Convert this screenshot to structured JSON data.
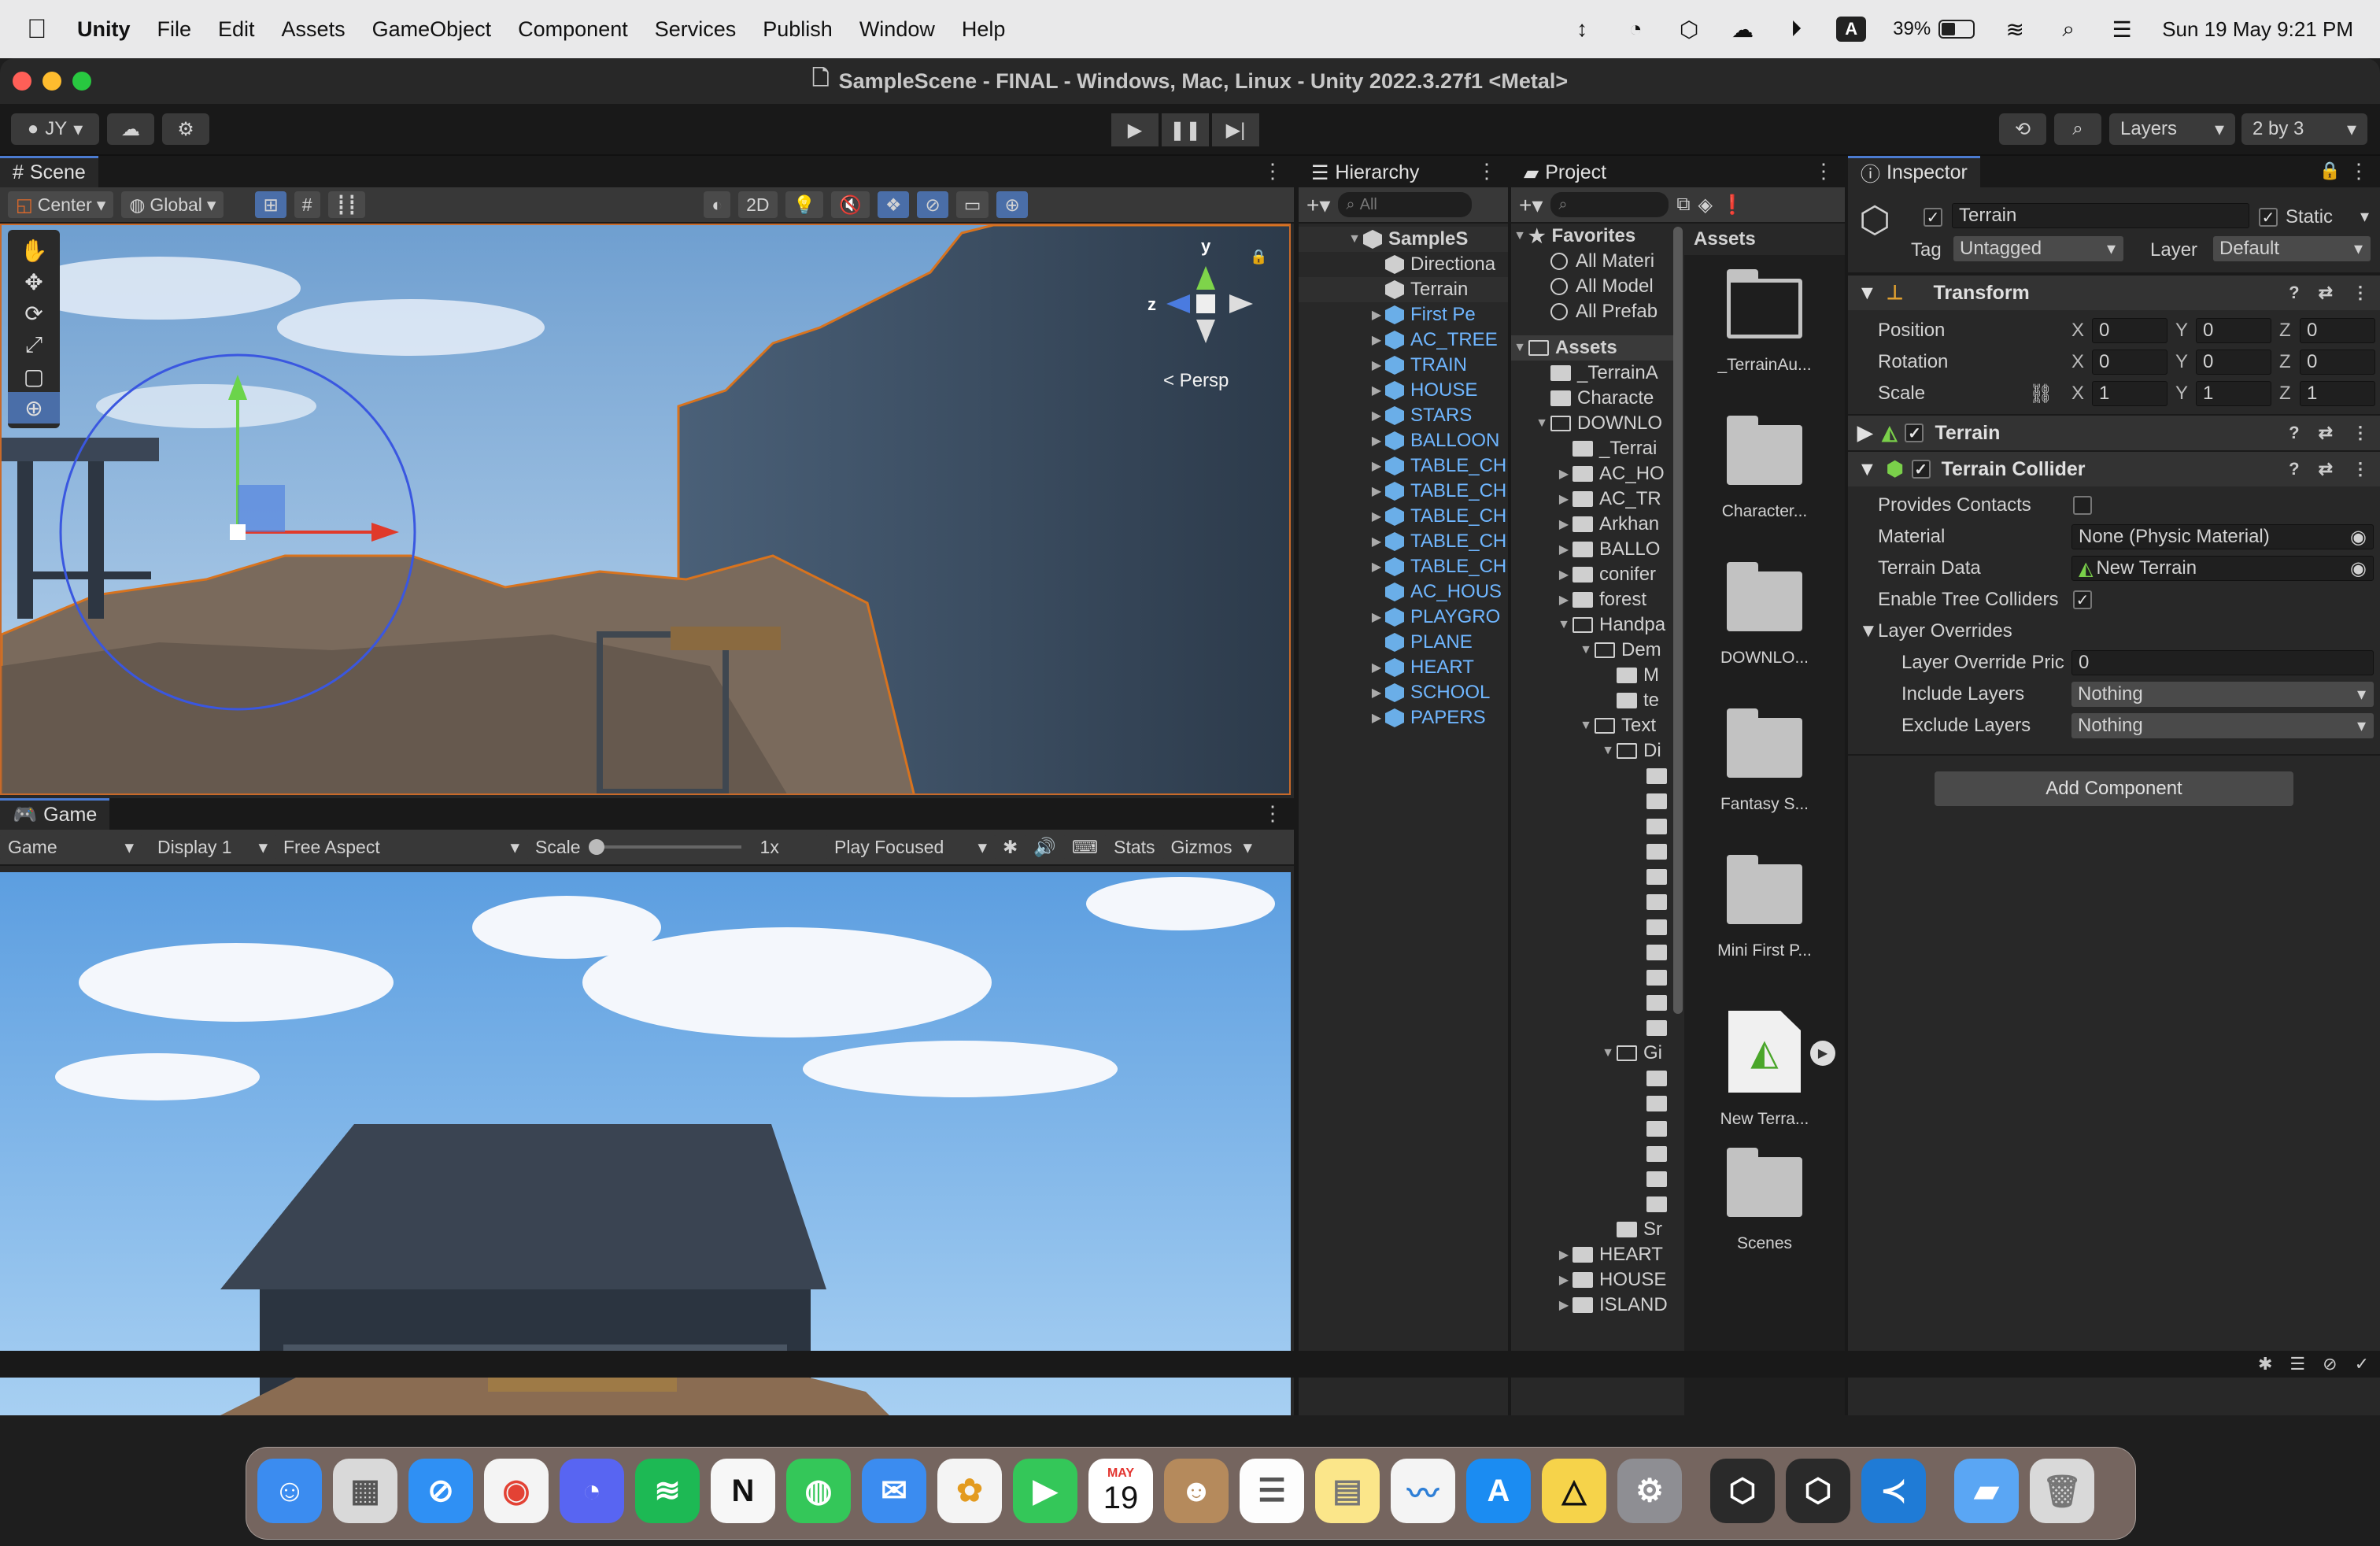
{
  "menubar": {
    "app": "Unity",
    "items": [
      "File",
      "Edit",
      "Assets",
      "GameObject",
      "Component",
      "Services",
      "Publish",
      "Window",
      "Help"
    ],
    "battery_pct": "39%",
    "battery_level": 0.39,
    "datetime": "Sun 19 May  9:21 PM",
    "input_source": "A"
  },
  "window": {
    "title": "SampleScene - FINAL - Windows, Mac, Linux - Unity 2022.3.27f1 <Metal>"
  },
  "toolbar": {
    "account": "JY",
    "layers_label": "Layers",
    "layout_label": "2 by 3"
  },
  "scene": {
    "tab": "Scene",
    "pivot": "Center",
    "space": "Global",
    "mode2d": "2D",
    "persp_label": "< Persp",
    "gizmo_axes": [
      "y",
      "z"
    ]
  },
  "game": {
    "tab": "Game",
    "view_select": "Game",
    "display": "Display 1",
    "aspect": "Free Aspect",
    "scale_label": "Scale",
    "scale_value": "1x",
    "play_mode": "Play Focused",
    "stats": "Stats",
    "gizmos": "Gizmos"
  },
  "hierarchy": {
    "tab": "Hierarchy",
    "search_placeholder": "All",
    "scene": "SampleS",
    "items": [
      {
        "label": "Directiona",
        "kind": "object",
        "arrow": ""
      },
      {
        "label": "Terrain",
        "kind": "object",
        "arrow": "",
        "selected": true
      },
      {
        "label": "First Pe",
        "kind": "prefab",
        "arrow": "▶"
      },
      {
        "label": "AC_TREE",
        "kind": "prefab",
        "arrow": "▶"
      },
      {
        "label": "TRAIN",
        "kind": "prefab",
        "arrow": "▶"
      },
      {
        "label": "HOUSE",
        "kind": "prefab",
        "arrow": "▶"
      },
      {
        "label": "STARS",
        "kind": "prefab",
        "arrow": "▶"
      },
      {
        "label": "BALLOON",
        "kind": "prefab",
        "arrow": "▶"
      },
      {
        "label": "TABLE_CH",
        "kind": "prefab",
        "arrow": "▶"
      },
      {
        "label": "TABLE_CH",
        "kind": "prefab",
        "arrow": "▶"
      },
      {
        "label": "TABLE_CH",
        "kind": "prefab",
        "arrow": "▶"
      },
      {
        "label": "TABLE_CH",
        "kind": "prefab",
        "arrow": "▶"
      },
      {
        "label": "TABLE_CH",
        "kind": "prefab",
        "arrow": "▶"
      },
      {
        "label": "AC_HOUS",
        "kind": "prefab",
        "arrow": ""
      },
      {
        "label": "PLAYGRO",
        "kind": "prefab",
        "arrow": "▶"
      },
      {
        "label": "PLANE",
        "kind": "prefab",
        "arrow": ""
      },
      {
        "label": "HEART",
        "kind": "prefab",
        "arrow": "▶"
      },
      {
        "label": "SCHOOL",
        "kind": "prefab",
        "arrow": "▶"
      },
      {
        "label": "PAPERS",
        "kind": "prefab",
        "arrow": "▶"
      }
    ]
  },
  "project": {
    "tab": "Project",
    "favorites_label": "Favorites",
    "favorites": [
      "All Materi",
      "All Model",
      "All Prefab"
    ],
    "assets_label": "Assets",
    "tree": [
      {
        "label": "_TerrainA",
        "indent": 1,
        "arrow": "",
        "open": false
      },
      {
        "label": "Characte",
        "indent": 1,
        "arrow": "",
        "open": false
      },
      {
        "label": "DOWNLO",
        "indent": 1,
        "arrow": "▼",
        "open": true
      },
      {
        "label": "_Terrai",
        "indent": 2,
        "arrow": "",
        "open": false
      },
      {
        "label": "AC_HO",
        "indent": 2,
        "arrow": "▶",
        "open": false
      },
      {
        "label": "AC_TR",
        "indent": 2,
        "arrow": "▶",
        "open": false
      },
      {
        "label": "Arkhan",
        "indent": 2,
        "arrow": "▶",
        "open": false
      },
      {
        "label": "BALLO",
        "indent": 2,
        "arrow": "▶",
        "open": false
      },
      {
        "label": "conifer",
        "indent": 2,
        "arrow": "▶",
        "open": false
      },
      {
        "label": "forest",
        "indent": 2,
        "arrow": "▶",
        "open": false
      },
      {
        "label": "Handpa",
        "indent": 2,
        "arrow": "▼",
        "open": true
      },
      {
        "label": "Dem",
        "indent": 3,
        "arrow": "▼",
        "open": true
      },
      {
        "label": "M",
        "indent": 4,
        "arrow": "",
        "open": false
      },
      {
        "label": "te",
        "indent": 4,
        "arrow": "",
        "open": false
      },
      {
        "label": "Text",
        "indent": 3,
        "arrow": "▼",
        "open": true
      },
      {
        "label": "Di",
        "indent": 4,
        "arrow": "▼",
        "open": true
      }
    ],
    "tree_tail": [
      {
        "label": "Gi",
        "indent": 4,
        "arrow": "▼",
        "open": true
      },
      {
        "label": "Sr",
        "indent": 4,
        "arrow": "",
        "open": false
      },
      {
        "label": "HEART",
        "indent": 2,
        "arrow": "▶",
        "open": false
      },
      {
        "label": "HOUSE",
        "indent": 2,
        "arrow": "▶",
        "open": false
      },
      {
        "label": "ISLAND",
        "indent": 2,
        "arrow": "▶",
        "open": false
      }
    ],
    "breadcrumb": "Assets",
    "grid": [
      {
        "label": "_TerrainAu...",
        "kind": "folder-open"
      },
      {
        "label": "Character...",
        "kind": "folder"
      },
      {
        "label": "DOWNLO...",
        "kind": "folder"
      },
      {
        "label": "Fantasy S...",
        "kind": "folder"
      },
      {
        "label": "Mini First P...",
        "kind": "folder"
      },
      {
        "label": "New Terra...",
        "kind": "terrain"
      },
      {
        "label": "Scenes",
        "kind": "folder"
      }
    ]
  },
  "inspector": {
    "tab": "Inspector",
    "object_name": "Terrain",
    "static_label": "Static",
    "tag_label": "Tag",
    "tag": "Untagged",
    "layer_label": "Layer",
    "layer": "Default",
    "transform": {
      "title": "Transform",
      "rows": [
        {
          "label": "Position",
          "x": "0",
          "y": "0",
          "z": "0"
        },
        {
          "label": "Rotation",
          "x": "0",
          "y": "0",
          "z": "0"
        },
        {
          "label": "Scale",
          "x": "1",
          "y": "1",
          "z": "1"
        }
      ],
      "axes": [
        "X",
        "Y",
        "Z"
      ]
    },
    "terrain": {
      "title": "Terrain"
    },
    "collider": {
      "title": "Terrain Collider",
      "provides_contacts": "Provides Contacts",
      "material_label": "Material",
      "material": "None (Physic Material)",
      "terrain_data_label": "Terrain Data",
      "terrain_data": "New Terrain",
      "tree_colliders": "Enable Tree Colliders",
      "layer_overrides": "Layer Overrides",
      "override_priority_label": "Layer Override Pric",
      "override_priority": "0",
      "include_label": "Include Layers",
      "include": "Nothing",
      "exclude_label": "Exclude Layers",
      "exclude": "Nothing"
    },
    "add_component": "Add Component"
  },
  "dock": {
    "calendar_month": "MAY",
    "calendar_day": "19"
  },
  "colors": {
    "accent": "#4b7bd1",
    "prefab": "#6fb6ff",
    "scene_border": "#c86a2a"
  }
}
